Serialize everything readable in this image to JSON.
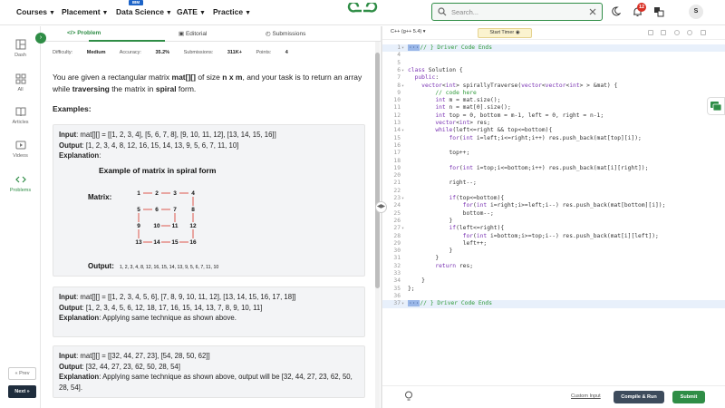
{
  "nav": {
    "courses": "Courses",
    "placement": "Placement",
    "data_science": "Data Science",
    "ibm_badge": "IBM",
    "gate": "GATE",
    "practice": "Practice"
  },
  "search": {
    "placeholder": "Search..."
  },
  "notifications": {
    "count": "12"
  },
  "avatar": {
    "initial": "S"
  },
  "sidebar": {
    "items": [
      {
        "label": "Dash",
        "icon": "dashboard-icon"
      },
      {
        "label": "All",
        "icon": "grid-icon"
      },
      {
        "label": "Articles",
        "icon": "book-icon"
      },
      {
        "label": "Videos",
        "icon": "video-icon"
      },
      {
        "label": "Problems",
        "icon": "code-icon"
      }
    ],
    "prev": "« Prev",
    "next": "Next »"
  },
  "tabs": {
    "problem": "Problem",
    "editorial": "Editorial",
    "submissions": "Submissions"
  },
  "meta": {
    "difficulty_label": "Difficulty:",
    "difficulty": "Medium",
    "accuracy_label": "Accuracy:",
    "accuracy": "35.2%",
    "submissions_label": "Submissions:",
    "submissions": "311K+",
    "points_label": "Points:",
    "points": "4"
  },
  "statement": {
    "p1": "You are given a rectangular matrix ",
    "mat": "mat[][]",
    "p2": " of size ",
    "size": "n x m",
    "p3": ", and your task is to return an array while ",
    "traversing": "traversing",
    "p4": " the matrix in ",
    "spiral": "spiral",
    "p5": " form."
  },
  "examples_heading": "Examples:",
  "examples": [
    {
      "input_label": "Input",
      "input": ": mat[][] = [[1, 2, 3, 4], [5, 6, 7, 8], [9, 10, 11, 12], [13, 14, 15, 16]]",
      "output_label": "Output",
      "output": ": [1, 2, 3, 4, 8, 12, 16, 15, 14, 13, 9, 5, 6, 7, 11, 10]",
      "explanation_label": "Explanation",
      "explanation": ":"
    },
    {
      "input_label": "Input",
      "input": ": mat[][] = [[1, 2, 3, 4, 5, 6], [7, 8, 9, 10, 11, 12], [13, 14, 15, 16, 17, 18]]",
      "output_label": "Output",
      "output": ": [1, 2, 3, 4, 5, 6, 12, 18, 17, 16, 15, 14, 13, 7, 8, 9, 10, 11]",
      "explanation_label": "Explanation",
      "explanation": ": Applying same technique as shown above."
    },
    {
      "input_label": "Input",
      "input": ": mat[][] = [[32, 44, 27, 23], [54, 28, 50, 62]]",
      "output_label": "Output",
      "output": ": [32, 44, 27, 23, 62, 50, 28, 54]",
      "explanation_label": "Explanation",
      "explanation": ": Applying same technique as shown above, output will be [32, 44, 27, 23, 62, 50, 28, 54]."
    }
  ],
  "figure": {
    "title": "Example of matrix in spiral form",
    "matrix_label": "Matrix:",
    "rows": [
      [
        "1",
        "2",
        "3",
        "4"
      ],
      [
        "5",
        "6",
        "7",
        "8"
      ],
      [
        "9",
        "10",
        "11",
        "12"
      ],
      [
        "13",
        "14",
        "15",
        "16"
      ]
    ],
    "output_label": "Output:",
    "output": "1, 2, 3, 4, 8, 12, 16, 15, 14, 13, 9, 5, 6, 7, 11, 10"
  },
  "editor": {
    "language": "C++ (g++ 5.4)",
    "timer": "Start Timer",
    "custom_input": "Custom Input",
    "compile": "Compile & Run",
    "submit": "Submit"
  },
  "code_lines": [
    {
      "n": "1",
      "fold": "+",
      "t": "// } Driver Code Ends",
      "hl": true
    },
    {
      "n": "4",
      "fold": "",
      "t": ""
    },
    {
      "n": "5",
      "fold": "",
      "t": ""
    },
    {
      "n": "6",
      "fold": "+",
      "t": "class Solution {"
    },
    {
      "n": "7",
      "fold": "",
      "t": "  public:"
    },
    {
      "n": "8",
      "fold": "+",
      "t": "    vector<int> spirallyTraverse(vector<vector<int> > &mat) {"
    },
    {
      "n": "9",
      "fold": "",
      "t": "        // code here"
    },
    {
      "n": "10",
      "fold": "",
      "t": "        int m = mat.size();"
    },
    {
      "n": "11",
      "fold": "",
      "t": "        int n = mat[0].size();"
    },
    {
      "n": "12",
      "fold": "",
      "t": "        int top = 0, bottom = m-1, left = 0, right = n-1;"
    },
    {
      "n": "13",
      "fold": "",
      "t": "        vector<int> res;"
    },
    {
      "n": "14",
      "fold": "+",
      "t": "        while(left<=right && top<=bottom){"
    },
    {
      "n": "15",
      "fold": "",
      "t": "            for(int i=left;i<=right;i++) res.push_back(mat[top][i]);"
    },
    {
      "n": "16",
      "fold": "",
      "t": ""
    },
    {
      "n": "17",
      "fold": "",
      "t": "            top++;"
    },
    {
      "n": "18",
      "fold": "",
      "t": ""
    },
    {
      "n": "19",
      "fold": "",
      "t": "            for(int i=top;i<=bottom;i++) res.push_back(mat[i][right]);"
    },
    {
      "n": "20",
      "fold": "",
      "t": ""
    },
    {
      "n": "21",
      "fold": "",
      "t": "            right--;"
    },
    {
      "n": "22",
      "fold": "",
      "t": ""
    },
    {
      "n": "23",
      "fold": "+",
      "t": "            if(top<=bottom){"
    },
    {
      "n": "24",
      "fold": "",
      "t": "                for(int i=right;i>=left;i--) res.push_back(mat[bottom][i]);"
    },
    {
      "n": "25",
      "fold": "",
      "t": "                bottom--;"
    },
    {
      "n": "26",
      "fold": "",
      "t": "            }"
    },
    {
      "n": "27",
      "fold": "+",
      "t": "            if(left<=right){"
    },
    {
      "n": "28",
      "fold": "",
      "t": "                for(int i=bottom;i>=top;i--) res.push_back(mat[i][left]);"
    },
    {
      "n": "29",
      "fold": "",
      "t": "                left++;"
    },
    {
      "n": "30",
      "fold": "",
      "t": "            }"
    },
    {
      "n": "31",
      "fold": "",
      "t": "        }"
    },
    {
      "n": "32",
      "fold": "",
      "t": "        return res;"
    },
    {
      "n": "33",
      "fold": "",
      "t": ""
    },
    {
      "n": "34",
      "fold": "",
      "t": "    }"
    },
    {
      "n": "35",
      "fold": "",
      "t": "};"
    },
    {
      "n": "36",
      "fold": "",
      "t": ""
    },
    {
      "n": "37",
      "fold": "+",
      "t": "// } Driver Code Ends",
      "hl": true
    }
  ]
}
